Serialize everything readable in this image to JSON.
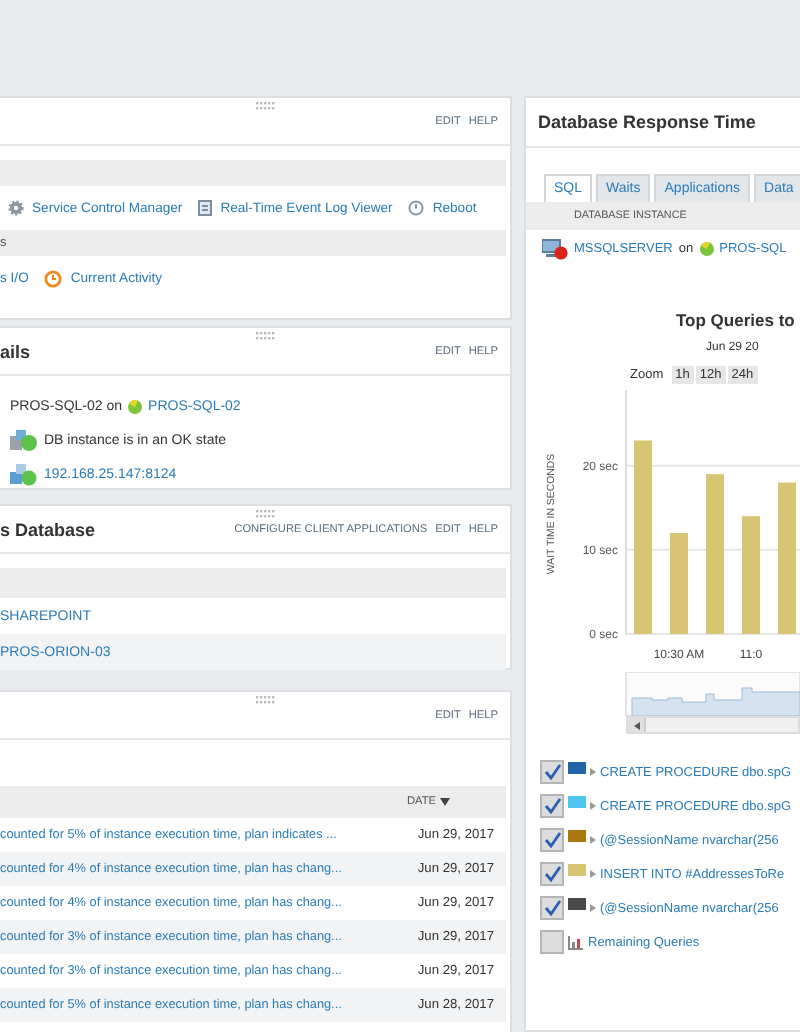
{
  "management_panel": {
    "actions": [
      "EDIT",
      "HELP"
    ],
    "section_2_label": "s",
    "tools": [
      {
        "kind": "service",
        "label": "Service Control Manager"
      },
      {
        "kind": "event-log",
        "label": "Real-Time Event Log Viewer"
      },
      {
        "kind": "reboot",
        "label": "Reboot"
      }
    ],
    "tools_2": [
      {
        "kind": "plain",
        "label": "s I/O"
      },
      {
        "kind": "activity",
        "label": "Current Activity"
      }
    ]
  },
  "details_panel": {
    "title": "ails",
    "actions": [
      "EDIT",
      "HELP"
    ],
    "rows": [
      {
        "kind": "host",
        "text": "PROS-SQL-02 on",
        "link": "PROS-SQL-02"
      },
      {
        "kind": "status",
        "text": "DB instance is in an OK state"
      },
      {
        "kind": "address",
        "link": "192.168.25.147:8124"
      }
    ]
  },
  "database_panel": {
    "title": "s Database",
    "actions": [
      "CONFIGURE CLIENT APPLICATIONS",
      "EDIT",
      "HELP"
    ],
    "rows": [
      "SHAREPOINT",
      "PROS-ORION-03"
    ]
  },
  "advice_panel": {
    "actions": [
      "EDIT",
      "HELP"
    ],
    "date_column": "DATE",
    "rows": [
      {
        "message": "counted for 5% of instance execution time, plan indicates ...",
        "date": "Jun 29, 2017"
      },
      {
        "message": "counted for 4% of instance execution time, plan has chang...",
        "date": "Jun 29, 2017"
      },
      {
        "message": "counted for 4% of instance execution time, plan has chang...",
        "date": "Jun 29, 2017"
      },
      {
        "message": "counted for 3% of instance execution time, plan has chang...",
        "date": "Jun 29, 2017"
      },
      {
        "message": "counted for 3% of instance execution time, plan has chang...",
        "date": "Jun 29, 2017"
      },
      {
        "message": "counted for 5% of instance execution time, plan has chang...",
        "date": "Jun 28, 2017"
      }
    ]
  },
  "response_panel": {
    "title": "Database Response Time",
    "tabs": [
      {
        "label": "SQL",
        "selected": true
      },
      {
        "label": "Waits",
        "selected": false
      },
      {
        "label": "Applications",
        "selected": false
      },
      {
        "label": "Data",
        "selected": false
      }
    ],
    "column": "DATABASE INSTANCE",
    "instance": {
      "name": "MSSQLSERVER",
      "on": "on",
      "host": "PROS-SQL"
    },
    "chart_title": "Top Queries to",
    "chart_date": "Jun 29 20",
    "zoom_label": "Zoom",
    "zoom_options": [
      "1h",
      "12h",
      "24h"
    ],
    "chart_data": {
      "type": "bar",
      "ylabel": "WAIT TIME IN SECONDS",
      "categories": [
        null,
        "10:30 AM",
        null,
        "11:0",
        null
      ],
      "values": [
        23,
        12,
        19,
        14,
        18
      ],
      "ylim": [
        0,
        29
      ],
      "yticks": [
        {
          "value": 0,
          "label": "0 sec"
        },
        {
          "value": 10,
          "label": "10 sec"
        },
        {
          "value": 20,
          "label": "20 sec"
        }
      ]
    },
    "legend": [
      {
        "checked": true,
        "color": "#1f67a8",
        "text": "CREATE PROCEDURE dbo.spG"
      },
      {
        "checked": true,
        "color": "#4cc6f0",
        "text": "CREATE PROCEDURE dbo.spG"
      },
      {
        "checked": true,
        "color": "#a8770e",
        "text": "(@SessionName nvarchar(256"
      },
      {
        "checked": true,
        "color": "#d8c574",
        "text": "INSERT INTO #AddressesToRe"
      },
      {
        "checked": true,
        "color": "#4a4a4a",
        "text": "(@SessionName nvarchar(256"
      },
      {
        "checked": false,
        "text": "Remaining Queries"
      }
    ]
  }
}
